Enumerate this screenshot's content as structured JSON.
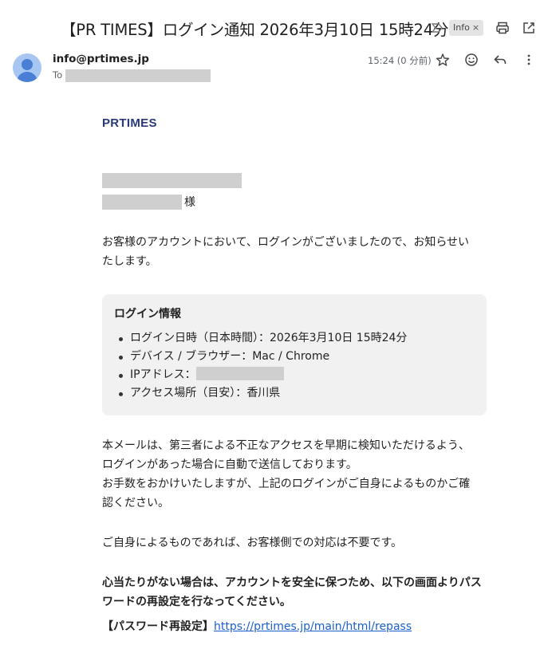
{
  "header": {
    "subject": "【PR TIMES】ログイン通知 2026年3月10日 15時24分",
    "label": "Info",
    "label_close": "×",
    "icons": [
      "importance-marker-icon",
      "print-icon",
      "open-in-new-window-icon"
    ]
  },
  "message_meta": {
    "from": "info@prtimes.jp",
    "to_label": "To",
    "time": "15:24 (0 分前)",
    "icons": [
      "star-icon",
      "emoji-icon",
      "reply-icon",
      "more-vert-icon"
    ]
  },
  "body": {
    "logo": "PRTIMES",
    "salutation_suffix": "様",
    "intro": [
      "お客様のアカウントにおいて、ログインがございましたので、お知らせい",
      "たします。"
    ],
    "info_box": {
      "title": "ログイン情報",
      "items": [
        {
          "label": "ログイン日時（日本時間）：",
          "value": "2026年3月10日 15時24分"
        },
        {
          "label": "デバイス / ブラウザー：",
          "value": "Mac / Chrome"
        },
        {
          "label": "IPアドレス：",
          "value": ""
        },
        {
          "label": "アクセス場所（目安）：",
          "value": "香川県"
        }
      ]
    },
    "paragraph2": [
      "本メールは、第三者による不正なアクセスを早期に検知いただけるよう、",
      "ログインがあった場合に自動で送信しております。",
      "お手数をおかけいたしますが、上記のログインがご自身によるものかご確",
      "認ください。"
    ],
    "paragraph3": "ご自身によるものであれば、お客様側での対応は不要です。",
    "warning": [
      "心当たりがない場合は、アカウントを安全に保つため、以下の画面よりパス",
      "ワードの再設定を行なってください。"
    ],
    "reset_label": "【パスワード再設定】",
    "reset_link": "https://prtimes.jp/main/html/repass"
  },
  "colors": {
    "accent_link": "#1a5fcc",
    "logo": "#283a78",
    "info_box_bg": "#f1f1f1",
    "redaction": "#cfcfcf"
  }
}
